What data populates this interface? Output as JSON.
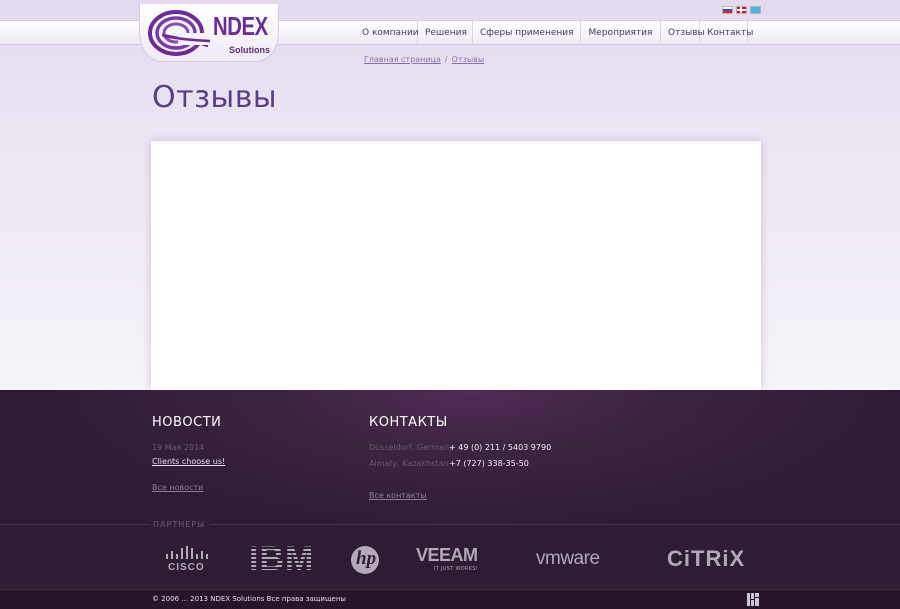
{
  "header": {
    "logo": {
      "brand": "NDEX",
      "tagline": "Solutions"
    },
    "languages": [
      {
        "code": "ru",
        "icon": "flag-ru-icon"
      },
      {
        "code": "en",
        "icon": "flag-en-icon"
      },
      {
        "code": "kz",
        "icon": "flag-kz-icon"
      }
    ],
    "nav": [
      {
        "label": "О компании"
      },
      {
        "label": "Решения"
      },
      {
        "label": "Сферы применения"
      },
      {
        "label": "Мероприятия"
      },
      {
        "label": "Отзывы"
      },
      {
        "label": "Контакты"
      }
    ]
  },
  "breadcrumb": {
    "home": "Главная страница",
    "separator": "/",
    "current": "Отзывы"
  },
  "page": {
    "title": "Отзывы"
  },
  "footer": {
    "news": {
      "heading": "НОВОСТИ",
      "date": "19 Мая 2014",
      "item": "Clients choose us!",
      "all_link": "Все новости"
    },
    "contacts": {
      "heading": "КОНТАКТЫ",
      "rows": [
        {
          "city": "Düsseldorf, Germany",
          "phone": "+ 49 (0) 211 / 5403 9790"
        },
        {
          "city": "Almaty, Kazakhstan",
          "phone": "+7 (727) 338-35-50"
        }
      ],
      "all_link": "Все контакты"
    },
    "partners": {
      "label": "ПАРТНЕРЫ",
      "logos": [
        "cisco-logo",
        "ibm-logo",
        "hp-logo",
        "veeam-logo",
        "vmware-logo",
        "citrix-logo"
      ],
      "cisco": "CISCO",
      "ibm": "IBM",
      "hp": "hp",
      "veeam": "VEEAM",
      "veeam_tag": "IT JUST WORKS!",
      "vmware": "vmware",
      "citrix": "CiTRiX"
    },
    "copyright": "© 2006 ... 2013 NDEX Solutions Все права защищены"
  },
  "colors": {
    "accent": "#6a2d96",
    "title": "#5a3e8a",
    "footer_bg": "#2d1d33"
  }
}
